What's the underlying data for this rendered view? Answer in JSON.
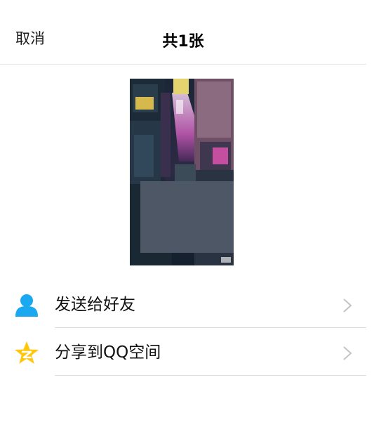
{
  "header": {
    "cancel_label": "取消",
    "title": "共1张"
  },
  "preview": {
    "icon": "city-night-photo"
  },
  "actions": [
    {
      "label": "发送给好友",
      "icon": "person-icon",
      "color": "#1aa8f0"
    },
    {
      "label": "分享到QQ空间",
      "icon": "qzone-star-icon",
      "color": "#ffc60a"
    }
  ],
  "colors": {
    "divider": "#dedede",
    "chevron": "#c4c4c4"
  }
}
